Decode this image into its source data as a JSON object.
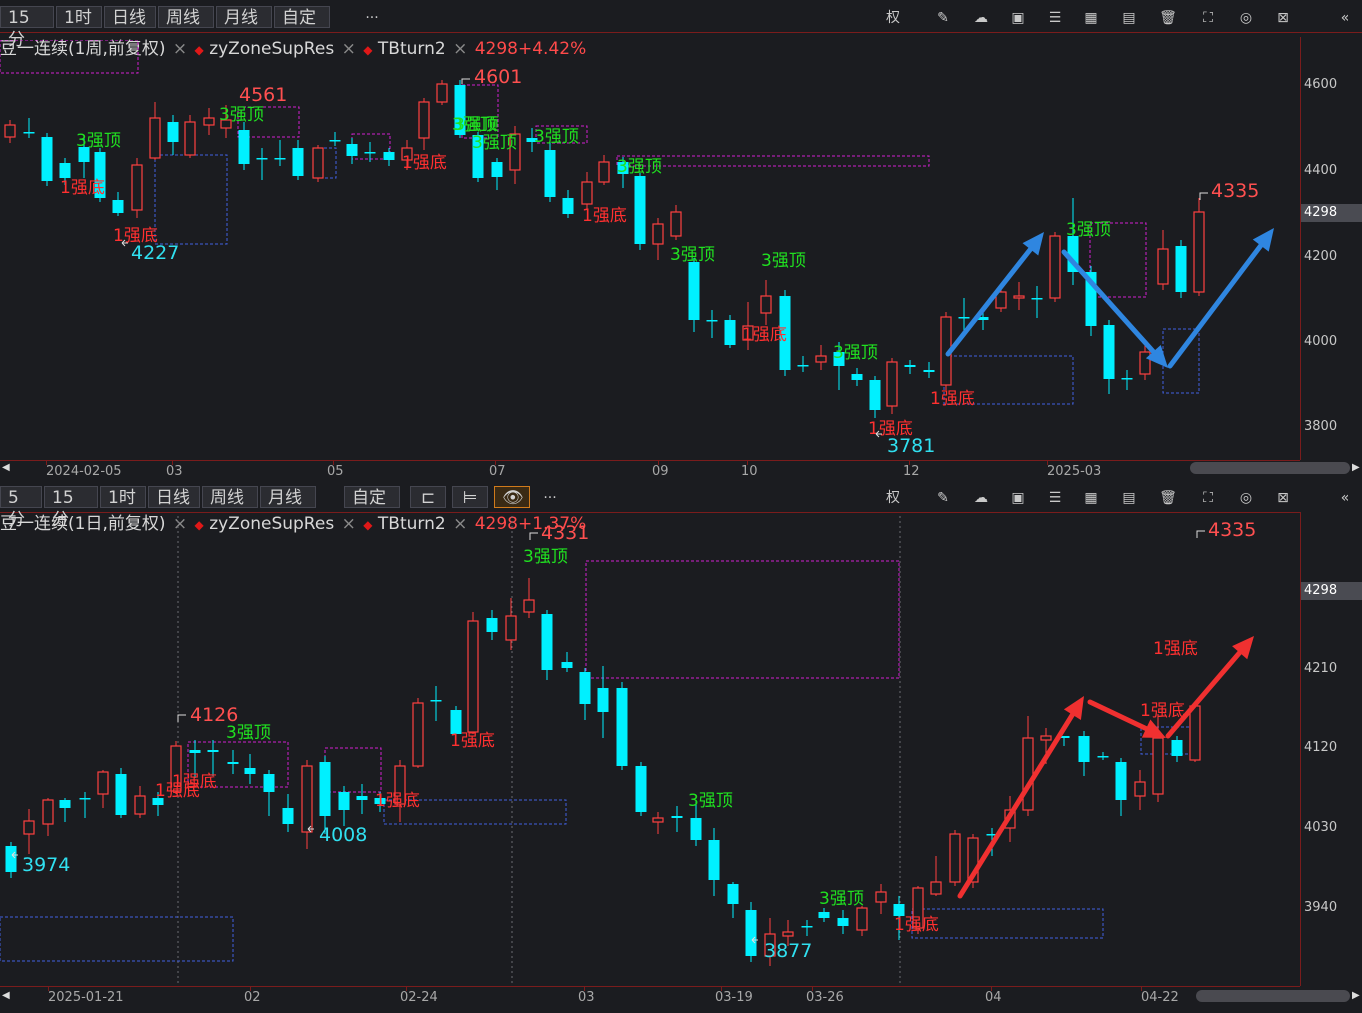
{
  "colors": {
    "up": "#ff4040",
    "down": "#00f0ff",
    "box_red": "#d020d0",
    "box_blue": "#4060e0",
    "arrow_blue": "#2f86e0",
    "arrow_red": "#f03030",
    "top_label": "#20e020",
    "bottom_label": "#ff3030",
    "high_label": "#ff5050",
    "low_label": "#30e0f0"
  },
  "top": {
    "periods": [
      "15分",
      "1时",
      "日线",
      "周线",
      "月线",
      "自定"
    ],
    "more": "···",
    "tool_icons": [
      "权",
      "pencil-icon",
      "cloud-download-icon",
      "image-icon",
      "sliders-icon",
      "calculator-icon",
      "layout-icon",
      "trash-icon",
      "expand-icon",
      "target-icon",
      "close-box-icon",
      "double-chevron-left-icon"
    ],
    "indicator": {
      "name": "豆一连续(1周,前复权)",
      "x": "×",
      "ind1": "zyZoneSupRes",
      "ind2": "TBturn2",
      "value": "4298+4.42%"
    },
    "price_ticks": [
      "4600",
      "4400",
      "4200",
      "4000",
      "3800"
    ],
    "current_price": "4298",
    "date_ticks": [
      "2024-02-05",
      "03",
      "05",
      "07",
      "09",
      "10",
      "12",
      "2025-03"
    ],
    "labels": {
      "h4561": "4561",
      "h4601": "4601",
      "l4227": "4227",
      "l3781": "3781",
      "h4335": "4335"
    }
  },
  "bottom": {
    "periods": [
      "5分",
      "15分",
      "1时",
      "日线",
      "周线",
      "月线",
      "自定"
    ],
    "more": "···",
    "tool_icons": [
      "权",
      "pencil-icon",
      "cloud-download-icon",
      "image-icon",
      "sliders-icon",
      "calculator-icon",
      "layout-icon",
      "trash-icon",
      "expand-icon",
      "target-icon",
      "close-box-icon",
      "double-chevron-left-icon"
    ],
    "indicator": {
      "name": "豆一连续(1日,前复权)",
      "x": "×",
      "ind1": "zyZoneSupRes",
      "ind2": "TBturn2",
      "value": "4298+1.37%"
    },
    "price_ticks": [
      "4210",
      "4120",
      "4030",
      "3940"
    ],
    "current_price": "4298",
    "date_ticks": [
      "2025-01-21",
      "02",
      "02-24",
      "03",
      "03-19",
      "03-26",
      "04",
      "04-22"
    ],
    "labels": {
      "h4126": "4126",
      "h4331": "4331",
      "l3974": "3974",
      "l4008": "4008",
      "l3877": "3877",
      "h4335": "4335"
    }
  },
  "signal_text": {
    "top": "3强顶",
    "bottom": "1强底"
  }
}
